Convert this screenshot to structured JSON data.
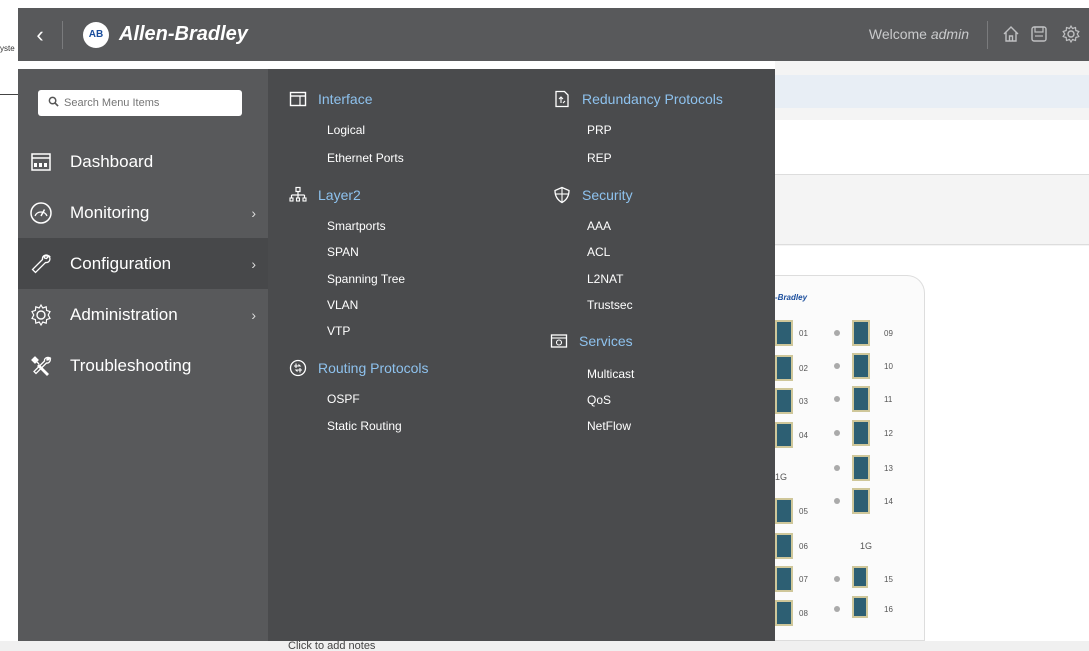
{
  "background": {
    "side_text": "yste",
    "footer_text": "Click to add notes"
  },
  "header": {
    "back_icon": "chevron-left-icon",
    "logo_text": "AB",
    "brand": "Allen-Bradley",
    "welcome_prefix": "Welcome",
    "welcome_user": "admin",
    "icons": [
      "home-icon",
      "save-icon",
      "gear-icon"
    ]
  },
  "sidebar": {
    "search_placeholder": "Search Menu Items",
    "items": [
      {
        "label": "Dashboard",
        "icon": "dashboard-icon",
        "has_submenu": false,
        "active": false
      },
      {
        "label": "Monitoring",
        "icon": "gauge-icon",
        "has_submenu": true,
        "active": false
      },
      {
        "label": "Configuration",
        "icon": "wrench-icon",
        "has_submenu": true,
        "active": true
      },
      {
        "label": "Administration",
        "icon": "cog-icon",
        "has_submenu": true,
        "active": false
      },
      {
        "label": "Troubleshooting",
        "icon": "tools-icon",
        "has_submenu": false,
        "active": false
      }
    ],
    "chevron": "›"
  },
  "menu": {
    "col1": [
      {
        "title": "Interface",
        "icon": "interface-icon",
        "items": [
          "Logical",
          "Ethernet Ports"
        ]
      },
      {
        "title": "Layer2",
        "icon": "network-tree-icon",
        "items": [
          "Smartports",
          "SPAN",
          "Spanning Tree",
          "VLAN",
          "VTP"
        ]
      },
      {
        "title": "Routing Protocols",
        "icon": "routing-icon",
        "items": [
          "OSPF",
          "Static Routing"
        ]
      }
    ],
    "col2": [
      {
        "title": "Redundancy Protocols",
        "icon": "redundancy-icon",
        "items": [
          "PRP",
          "REP"
        ]
      },
      {
        "title": "Security",
        "icon": "shield-icon",
        "items": [
          "AAA",
          "ACL",
          "L2NAT",
          "Trustsec"
        ]
      },
      {
        "title": "Services",
        "icon": "services-icon",
        "items": [
          "Multicast",
          "QoS",
          "NetFlow"
        ]
      }
    ]
  },
  "switch_panel": {
    "brand": "-Bradley",
    "left_ports": [
      "01",
      "02",
      "03",
      "04",
      "05",
      "06",
      "07",
      "08"
    ],
    "right_ports": [
      "09",
      "10",
      "11",
      "12",
      "13",
      "14",
      "15",
      "16"
    ],
    "speed_left": "1G",
    "speed_right": "1G"
  },
  "colors": {
    "header_bg": "#58595b",
    "menu_bg": "#4a4b4d",
    "section_title": "#8ec2ee",
    "active_item": "#47484a"
  }
}
